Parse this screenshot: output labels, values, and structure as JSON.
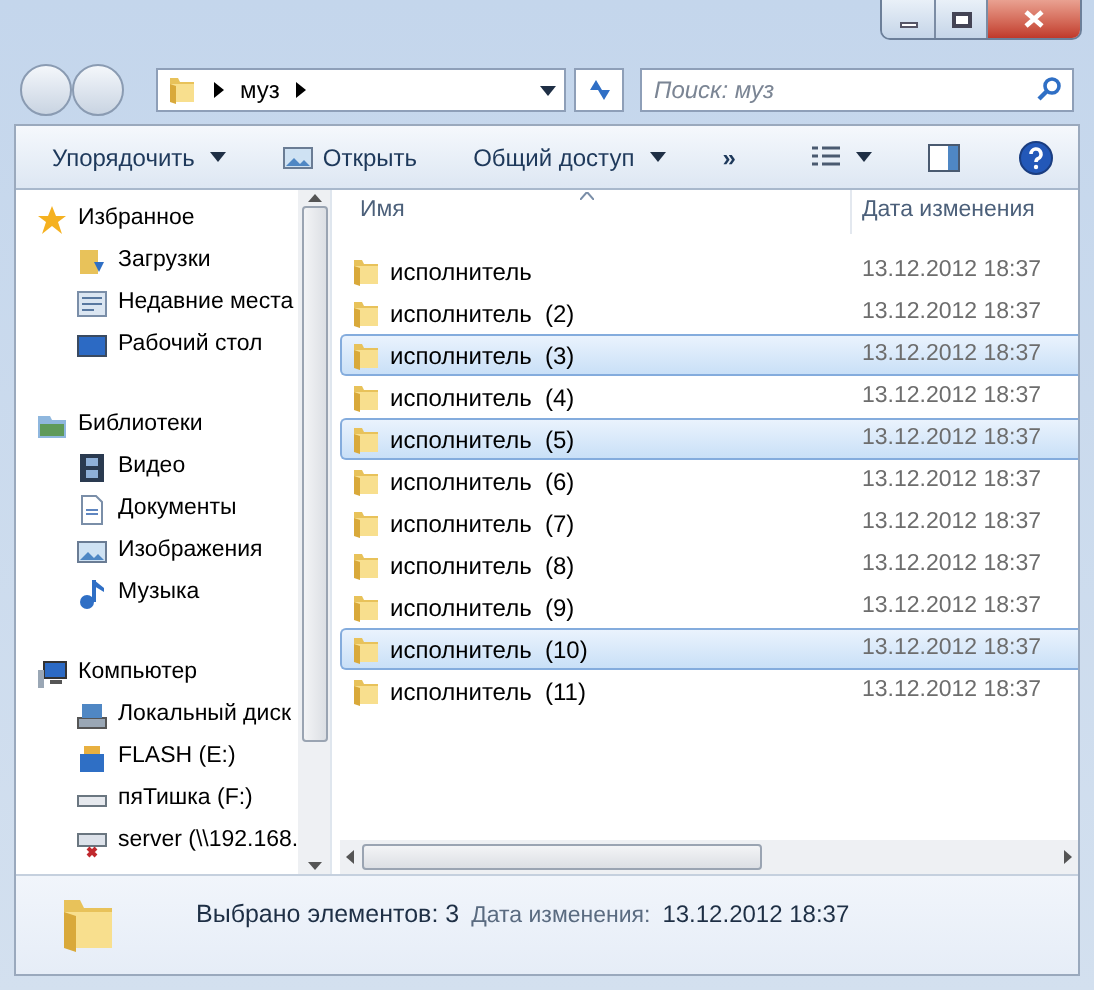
{
  "address": {
    "segments": [
      "муз"
    ]
  },
  "search": {
    "placeholder": "Поиск: муз"
  },
  "toolbar": {
    "items": [
      {
        "label": "Упорядочить",
        "kind": "menu"
      },
      {
        "label": "Открыть",
        "kind": "open"
      },
      {
        "label": "Общий доступ",
        "kind": "menu"
      },
      {
        "label": "»",
        "kind": "more"
      }
    ]
  },
  "sidebar": {
    "groups": [
      {
        "label": "Избранное",
        "kind": "star",
        "children": [
          {
            "label": "Загрузки",
            "kind": "downloads"
          },
          {
            "label": "Недавние места",
            "kind": "recent"
          },
          {
            "label": "Рабочий стол",
            "kind": "desktop"
          }
        ]
      },
      {
        "label": "Библиотеки",
        "kind": "library",
        "children": [
          {
            "label": "Видео",
            "kind": "video"
          },
          {
            "label": "Документы",
            "kind": "document"
          },
          {
            "label": "Изображения",
            "kind": "image"
          },
          {
            "label": "Музыка",
            "kind": "music"
          }
        ]
      },
      {
        "label": "Компьютер",
        "kind": "computer",
        "children": [
          {
            "label": "Локальный диск",
            "kind": "disk"
          },
          {
            "label": "FLASH (E:)",
            "kind": "sd"
          },
          {
            "label": "пяТишка (F:)",
            "kind": "drive"
          },
          {
            "label": "server (\\\\192.168.",
            "kind": "network"
          }
        ]
      }
    ]
  },
  "table": {
    "columns": [
      "Имя",
      "Дата изменения"
    ],
    "rows": [
      {
        "name": "исполнитель",
        "date": "13.12.2012 18:37",
        "selected": false
      },
      {
        "name": "исполнитель  (2)",
        "date": "13.12.2012 18:37",
        "selected": false
      },
      {
        "name": "исполнитель  (3)",
        "date": "13.12.2012 18:37",
        "selected": true
      },
      {
        "name": "исполнитель  (4)",
        "date": "13.12.2012 18:37",
        "selected": false
      },
      {
        "name": "исполнитель  (5)",
        "date": "13.12.2012 18:37",
        "selected": true
      },
      {
        "name": "исполнитель  (6)",
        "date": "13.12.2012 18:37",
        "selected": false
      },
      {
        "name": "исполнитель  (7)",
        "date": "13.12.2012 18:37",
        "selected": false
      },
      {
        "name": "исполнитель  (8)",
        "date": "13.12.2012 18:37",
        "selected": false
      },
      {
        "name": "исполнитель  (9)",
        "date": "13.12.2012 18:37",
        "selected": false
      },
      {
        "name": "исполнитель  (10)",
        "date": "13.12.2012 18:37",
        "selected": true
      },
      {
        "name": "исполнитель  (11)",
        "date": "13.12.2012 18:37",
        "selected": false
      }
    ]
  },
  "status_bar": {
    "count": "Выбрано элементов: 3",
    "date_label": "Дата изменения:",
    "date": "13.12.2012 18:37"
  }
}
